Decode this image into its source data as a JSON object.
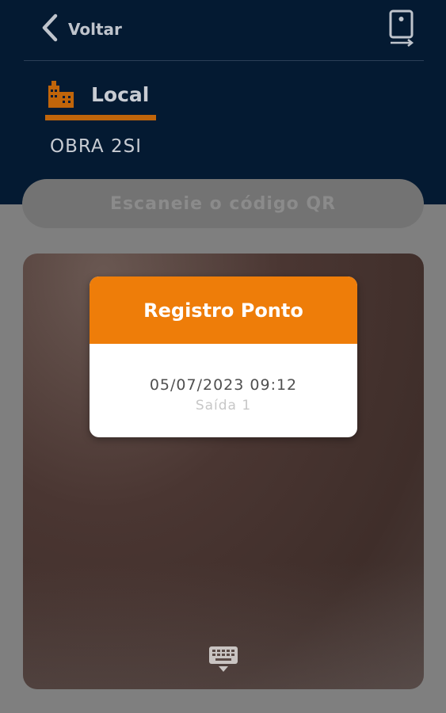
{
  "header": {
    "back_label": "Voltar",
    "back_icon": "chevron-left-icon",
    "device_icon": "device-exit-icon",
    "local_icon": "building-icon",
    "local_label": "Local",
    "obra": "OBRA 2SI"
  },
  "scan": {
    "label": "Escaneie o código QR"
  },
  "camera": {
    "keyboard_icon": "keyboard-icon"
  },
  "modal": {
    "title": "Registro Ponto",
    "datetime": "05/07/2023 09:12",
    "subtitle": "Saída 1"
  },
  "colors": {
    "header_bg": "#041a32",
    "accent": "#ee7d09",
    "underline": "#c0650a"
  }
}
